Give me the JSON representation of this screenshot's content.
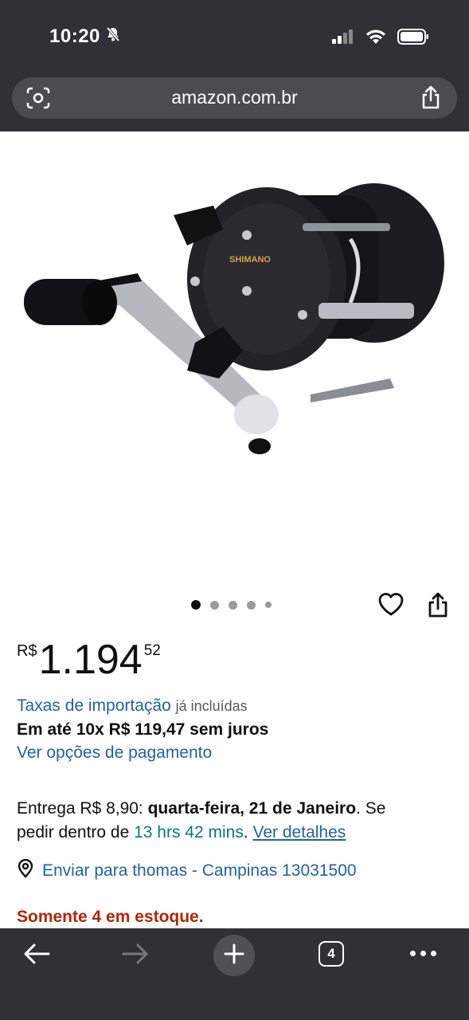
{
  "status_bar": {
    "time": "10:20"
  },
  "browser": {
    "url": "amazon.com.br",
    "tab_count": "4"
  },
  "gallery": {
    "image_brand": "SHIMANO",
    "image_count": 5,
    "active_index": 0
  },
  "price": {
    "currency": "R$",
    "whole": "1.194",
    "fraction": "52"
  },
  "import_fees": {
    "link": "Taxas de importação",
    "note": "já incluídas"
  },
  "installments": "Em até 10x R$ 119,47 sem juros",
  "payment_options_link": "Ver opções de pagamento",
  "delivery": {
    "prefix": "Entrega R$ 8,90: ",
    "date": "quarta-feira, 21 de Janeiro",
    "mid": ". Se",
    "line2_prefix": "pedir dentro de ",
    "countdown": "13 hrs 42 mins",
    "line2_mid": ". ",
    "details_link": "Ver detalhes"
  },
  "ship_to": "Enviar para thomas - Campinas 13031500",
  "stock": "Somente 4 em estoque."
}
